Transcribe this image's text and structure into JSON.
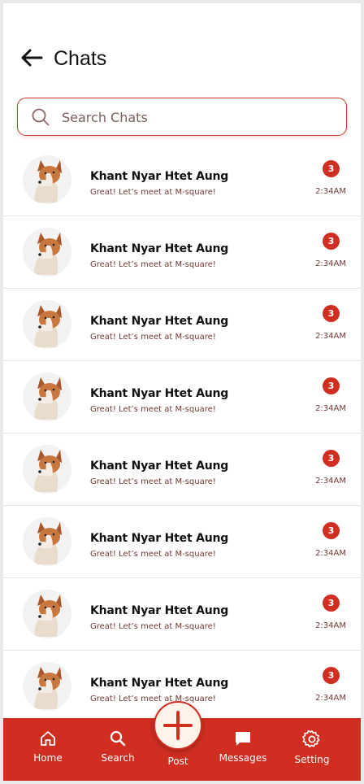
{
  "header": {
    "title": "Chats",
    "back_icon": "arrow-left-icon"
  },
  "search": {
    "placeholder": "Search Chats",
    "value": ""
  },
  "chats": [
    {
      "name": "Khant Nyar Htet Aung",
      "message": "Great! Let’s meet at M-square!",
      "unread": "3",
      "time": "2:34AM"
    },
    {
      "name": "Khant Nyar Htet Aung",
      "message": "Great! Let’s meet at M-square!",
      "unread": "3",
      "time": "2:34AM"
    },
    {
      "name": "Khant Nyar Htet Aung",
      "message": "Great! Let’s meet at M-square!",
      "unread": "3",
      "time": "2:34AM"
    },
    {
      "name": "Khant Nyar Htet Aung",
      "message": "Great! Let’s meet at M-square!",
      "unread": "3",
      "time": "2:34AM"
    },
    {
      "name": "Khant Nyar Htet Aung",
      "message": "Great! Let’s meet at M-square!",
      "unread": "3",
      "time": "2:34AM"
    },
    {
      "name": "Khant Nyar Htet Aung",
      "message": "Great! Let’s meet at M-square!",
      "unread": "3",
      "time": "2:34AM"
    },
    {
      "name": "Khant Nyar Htet Aung",
      "message": "Great! Let’s meet at M-square!",
      "unread": "3",
      "time": "2:34AM"
    },
    {
      "name": "Khant Nyar Htet Aung",
      "message": "Great! Let’s meet at M-square!",
      "unread": "3",
      "time": "2:34AM"
    }
  ],
  "nav": {
    "home": "Home",
    "search": "Search",
    "post": "Post",
    "messages": "Messages",
    "setting": "Setting"
  },
  "colors": {
    "accent": "#cf2e21",
    "text_muted": "#6e3a34",
    "post_bg": "#fff3ea"
  },
  "icons": [
    "arrow-left-icon",
    "search-icon",
    "home-icon",
    "plus-icon",
    "chat-bubble-icon",
    "gear-icon",
    "dog-avatar"
  ]
}
